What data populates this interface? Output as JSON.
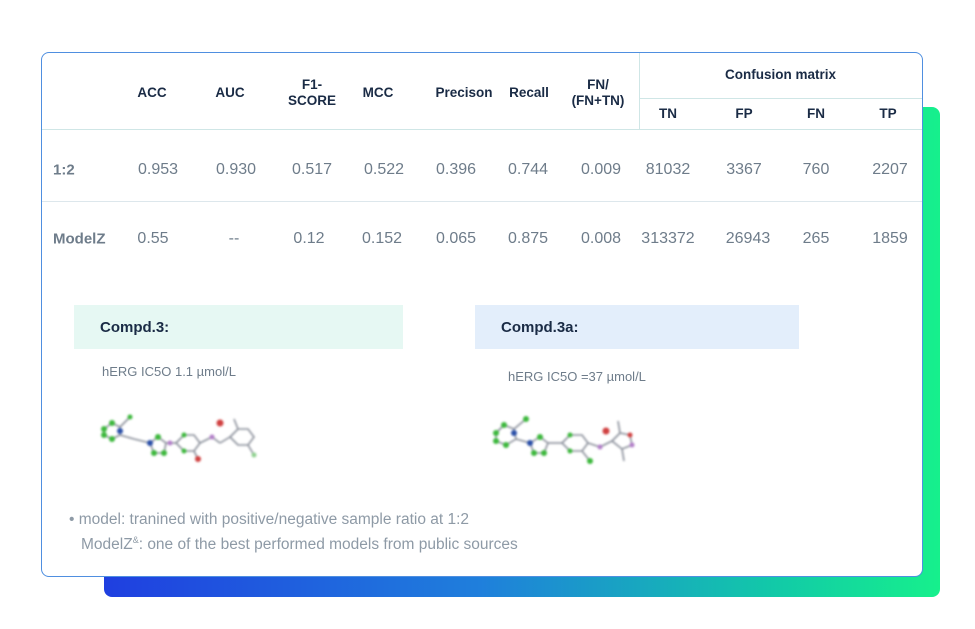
{
  "table": {
    "headers": {
      "acc": "ACC",
      "auc": "AUC",
      "f1_line1": "F1-",
      "f1_line2": "SCORE",
      "mcc": "MCC",
      "precision": "Precison",
      "recall": "Recall",
      "fn_ratio_line1": "FN/",
      "fn_ratio_line2": "(FN+TN)",
      "confusion_matrix": "Confusion matrix",
      "tn": "TN",
      "fp": "FP",
      "fn": "FN",
      "tp": "TP"
    },
    "rows": [
      {
        "label": "1:2",
        "acc": "0.953",
        "auc": "0.930",
        "f1": "0.517",
        "mcc": "0.522",
        "precision": "0.396",
        "recall": "0.744",
        "fn_ratio": "0.009",
        "tn": "81032",
        "fp": "3367",
        "fn": "760",
        "tp": "2207"
      },
      {
        "label": "ModelZ",
        "acc": "0.55",
        "auc": "--",
        "f1": "0.12",
        "mcc": "0.152",
        "precision": "0.065",
        "recall": "0.875",
        "fn_ratio": "0.008",
        "tn": "313372",
        "fp": "26943",
        "fn": "265",
        "tp": "1859"
      }
    ]
  },
  "compounds": [
    {
      "name": "Compd.3:",
      "herg": "hERG IC5O 1.1 µmol/L",
      "box_color": "#e6f8f3",
      "structure_icon": "molecule-structure-icon"
    },
    {
      "name": "Compd.3a:",
      "herg": "hERG IC5O =37 µmol/L",
      "box_color": "#e3eefb",
      "structure_icon": "molecule-structure-icon"
    }
  ],
  "footnotes": {
    "line1": "• model: tranined with positive/negative sample ratio at 1:2",
    "line2_main": "ModelZ",
    "line2_sup": "&",
    "line2_rest": ": one of the best performed models from public sources"
  },
  "colors": {
    "card_border": "#4f8fe0",
    "gradient_start": "#1f3fe0",
    "gradient_end": "#16f08c",
    "atom_green": "#3cb83c",
    "atom_blue": "#2a4fa8",
    "atom_red": "#d04040"
  }
}
